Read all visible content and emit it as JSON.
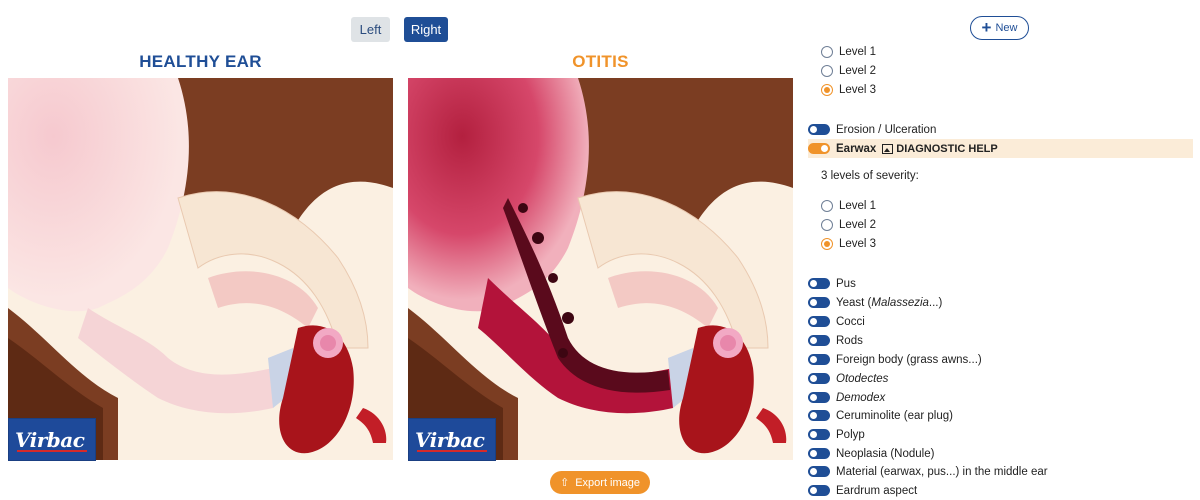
{
  "toolbar": {
    "left_label": "Left",
    "right_label": "Right",
    "new_label": "New",
    "export_label": "Export image"
  },
  "panels": {
    "left_title": "HEALTHY EAR",
    "right_title": "OTITIS",
    "logo_text": "Virbac"
  },
  "sidebar": {
    "top_levels": [
      {
        "label": "Level 1",
        "selected": false
      },
      {
        "label": "Level 2",
        "selected": false
      },
      {
        "label": "Level 3",
        "selected": true
      }
    ],
    "erosion_label": "Erosion / Ulceration",
    "earwax_label": "Earwax",
    "diagnostic_label": "DIAGNOSTIC HELP",
    "severity_text": "3 levels of severity:",
    "earwax_levels": [
      {
        "label": "Level 1",
        "selected": false
      },
      {
        "label": "Level 2",
        "selected": false
      },
      {
        "label": "Level 3",
        "selected": true
      }
    ],
    "items": [
      {
        "label": "Pus",
        "italic": false
      },
      {
        "label_pre": "Yeast (",
        "label_it": "Malassezia",
        "label_post": "...)"
      },
      {
        "label": "Cocci",
        "italic": false
      },
      {
        "label": "Rods",
        "italic": false
      },
      {
        "label": "Foreign body (grass awns...)",
        "italic": false
      },
      {
        "label": "Otodectes",
        "italic": true
      },
      {
        "label": "Demodex",
        "italic": true
      },
      {
        "label": "Ceruminolite (ear plug)",
        "italic": false
      },
      {
        "label": "Polyp",
        "italic": false
      },
      {
        "label": "Neoplasia (Nodule)",
        "italic": false
      },
      {
        "label": "Material (earwax, pus...) in the middle ear",
        "italic": false
      },
      {
        "label": "Eardrum aspect",
        "italic": false
      }
    ]
  },
  "colors": {
    "brand_blue": "#1f4e96",
    "accent_orange": "#f0932a"
  }
}
